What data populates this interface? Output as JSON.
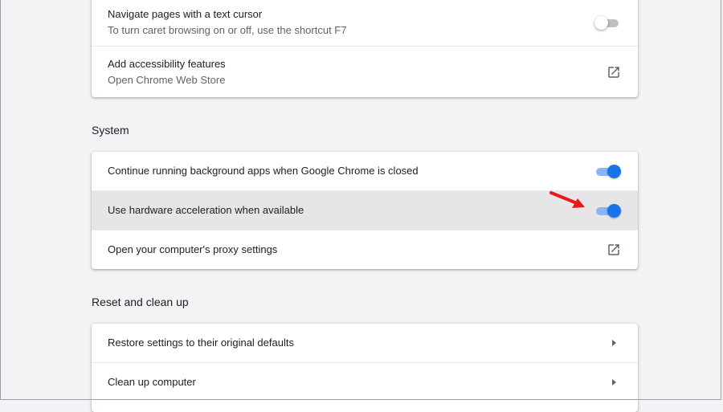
{
  "accessibility": {
    "items": [
      {
        "label": "Navigate pages with a text cursor",
        "sub": "To turn caret browsing on or off, use the shortcut F7",
        "toggle": "off"
      },
      {
        "label": "Add accessibility features",
        "sub": "Open Chrome Web Store",
        "icon": "open-in-new-icon"
      }
    ]
  },
  "system": {
    "heading": "System",
    "items": [
      {
        "label": "Continue running background apps when Google Chrome is closed",
        "toggle": "on"
      },
      {
        "label": "Use hardware acceleration when available",
        "toggle": "on",
        "highlighted": true
      },
      {
        "label": "Open your computer's proxy settings",
        "icon": "open-in-new-icon"
      }
    ]
  },
  "reset": {
    "heading": "Reset and clean up",
    "items": [
      {
        "label": "Restore settings to their original defaults",
        "icon": "arrow-right-icon"
      },
      {
        "label": "Clean up computer",
        "icon": "arrow-right-icon"
      }
    ]
  },
  "colors": {
    "accent": "#1a73e8",
    "annotation_arrow": "#e8181f",
    "highlight_row": "#e6e6e6"
  }
}
